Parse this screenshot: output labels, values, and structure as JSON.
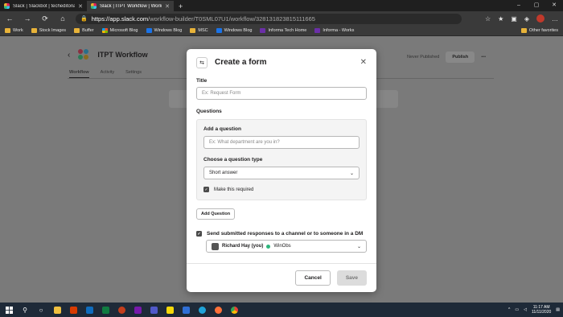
{
  "browser": {
    "tabs": [
      {
        "title": "Slack | Slackbot | techeditorial",
        "active": false
      },
      {
        "title": "Slack | ITPT Workflow | Workflow",
        "active": true
      }
    ],
    "new_tab": "+",
    "window_controls": [
      "–",
      "▢",
      "✕"
    ],
    "nav": {
      "back": "←",
      "forward": "→",
      "refresh": "⟳",
      "home": "⌂"
    },
    "url_host": "https://app.slack.com",
    "url_path": "/workflow-builder/T0SML07U1/workflow/328131823815111665",
    "bookmarks": [
      {
        "label": "Work",
        "color": "folder"
      },
      {
        "label": "Stock Images",
        "color": "folder"
      },
      {
        "label": "Buffer",
        "color": "folder"
      },
      {
        "label": "Microsoft Blog",
        "color": "ms"
      },
      {
        "label": "Windows Blog",
        "color": "blue"
      },
      {
        "label": "MSC",
        "color": "folder"
      },
      {
        "label": "Windows Blog",
        "color": "blue"
      },
      {
        "label": "Informa Tech Home",
        "color": "purple"
      },
      {
        "label": "Informa - Works",
        "color": "purple"
      }
    ],
    "other_favorites": "Other favorites"
  },
  "workflow": {
    "title": "ITPT Workflow",
    "tabs": [
      "Workflow",
      "Activity",
      "Settings"
    ],
    "status": "Never Published",
    "publish": "Publish",
    "more": "•••"
  },
  "modal": {
    "title": "Create a form",
    "title_label": "Title",
    "title_placeholder": "Ex: Request Form",
    "questions_label": "Questions",
    "add_question_label": "Add a question",
    "question_placeholder": "Ex: What department are you in?",
    "question_type_label": "Choose a question type",
    "question_type_value": "Short answer",
    "required_label": "Make this required",
    "required_checked": true,
    "add_question_button": "Add Question",
    "send_label": "Send submitted responses to a channel or to someone in a DM",
    "send_checked": true,
    "recipient_user": "Richard Hay (you)",
    "recipient_channel": "WinObs",
    "cancel": "Cancel",
    "save": "Save"
  },
  "taskbar": {
    "time": "11:17 AM",
    "date": "11/11/2020",
    "start_icon": "windows-logo",
    "search_icon": "search",
    "apps": [
      {
        "name": "task-view",
        "color": "#ffffff"
      },
      {
        "name": "file-explorer",
        "color": "#f0c040"
      },
      {
        "name": "office",
        "color": "#d83b01"
      },
      {
        "name": "outlook",
        "color": "#0f6cbd"
      },
      {
        "name": "excel",
        "color": "#107c41"
      },
      {
        "name": "powerpoint",
        "color": "#c43e1c"
      },
      {
        "name": "onenote",
        "color": "#7719aa"
      },
      {
        "name": "teams",
        "color": "#5059c9"
      },
      {
        "name": "sticky-notes",
        "color": "#f5d90a"
      },
      {
        "name": "snip",
        "color": "#2f6fd6"
      },
      {
        "name": "edge",
        "color": "#1fa3d8"
      },
      {
        "name": "firefox",
        "color": "#ff7139"
      },
      {
        "name": "chrome",
        "color": "#34a853"
      }
    ]
  }
}
